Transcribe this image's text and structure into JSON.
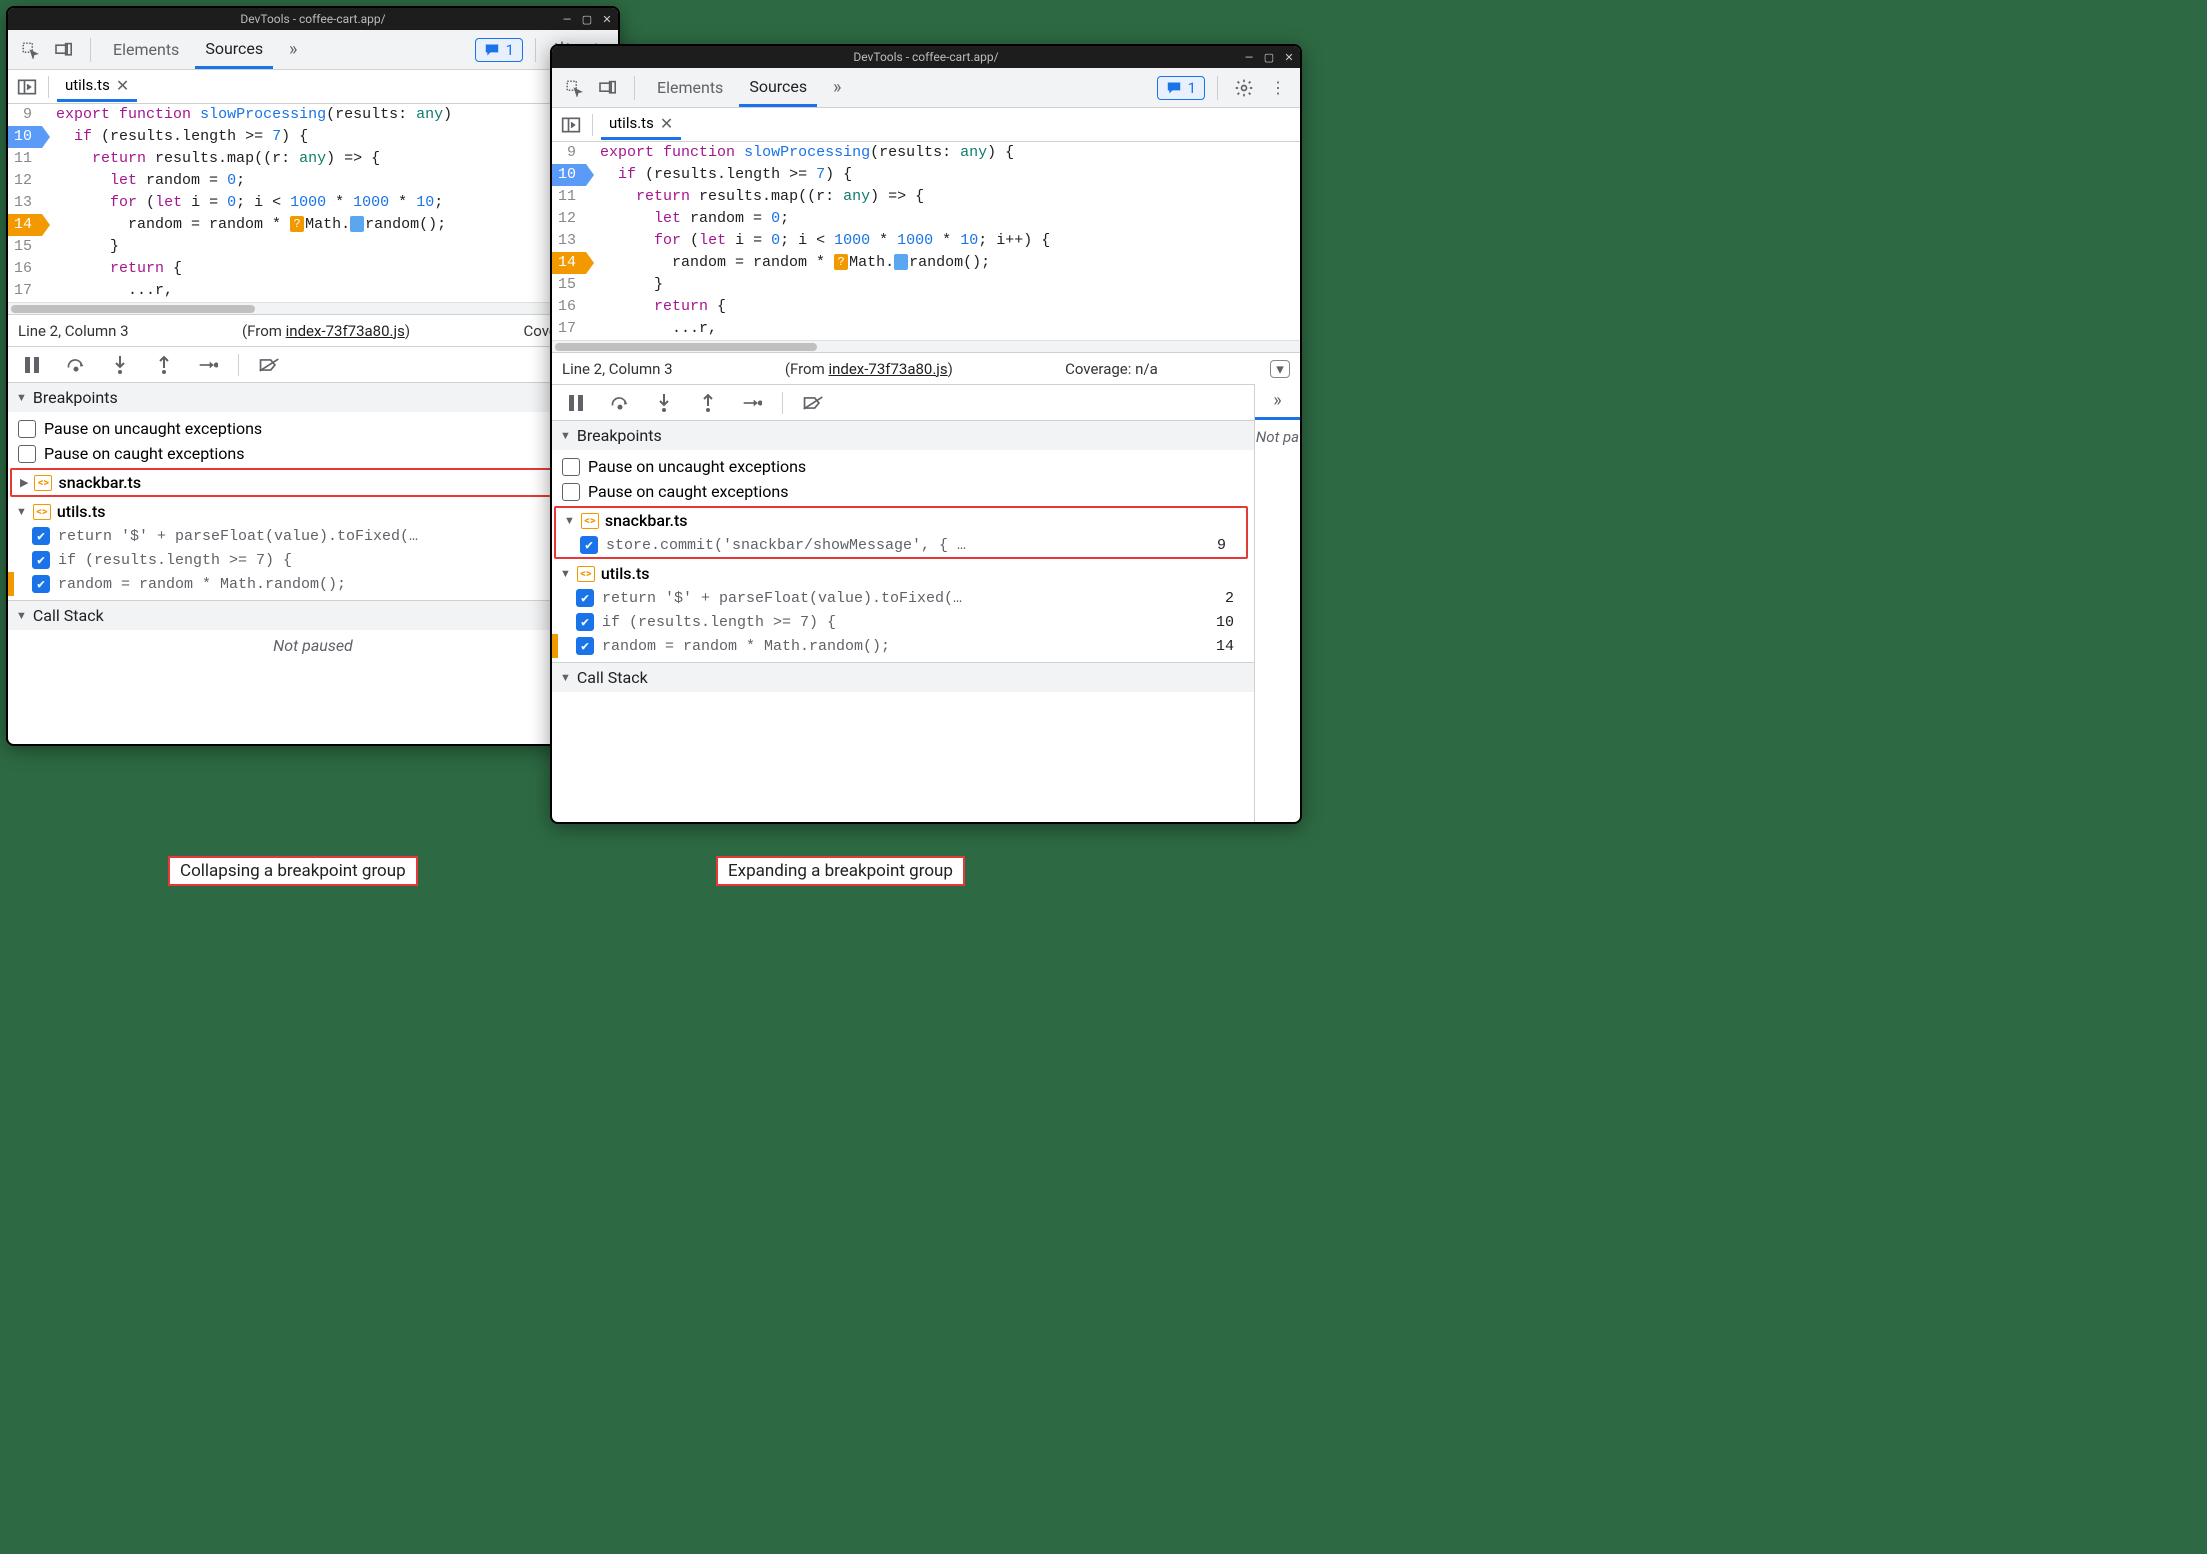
{
  "shared": {
    "window_title": "DevTools - coffee-cart.app/",
    "tabs": {
      "elements": "Elements",
      "sources": "Sources"
    },
    "issues_count": "1",
    "file_tab": "utils.ts",
    "code_lines": [
      {
        "n": "9",
        "html": "<span class='kw'>export</span> <span class='kw'>function</span> <span class='fn'>slowProcessing</span>(<span class='ident'>results</span>: <span class='type'>any</span>)"
      },
      {
        "n": "10",
        "html": "  <span class='kw'>if</span> (results.length >= <span class='num'>7</span>) {",
        "bp": true
      },
      {
        "n": "11",
        "html": "    <span class='kw'>return</span> results.map((<span class='ident'>r</span>: <span class='type'>any</span>) => {"
      },
      {
        "n": "12",
        "html": "      <span class='kw'>let</span> random = <span class='num'>0</span>;"
      },
      {
        "n": "13",
        "html": "      <span class='kw'>for</span> (<span class='kw'>let</span> i = <span class='num'>0</span>; i < <span class='num'>1000</span> * <span class='num'>1000</span> * <span class='num'>10</span>;"
      },
      {
        "n": "14",
        "html": "        random = random * <span class='inline-marker'>?</span>Math.<span class='inline-marker blue'>&nbsp;</span>random();",
        "cond": true
      },
      {
        "n": "15",
        "html": "      }"
      },
      {
        "n": "16",
        "html": "      <span class='kw'>return</span> {"
      },
      {
        "n": "17",
        "html": "        ...r,"
      }
    ],
    "code_line13_full": "      <span class='kw'>for</span> (<span class='kw'>let</span> i = <span class='num'>0</span>; i < <span class='num'>1000</span> * <span class='num'>1000</span> * <span class='num'>10</span>; i++) {",
    "code_line9_suffix_left": "",
    "code_line9_suffix_right": " {",
    "status_pos": "Line 2, Column 3",
    "status_from_prefix": "(From ",
    "status_from_link": "index-73f73a80.js",
    "status_from_suffix": ")",
    "status_coverage_left": "Coverage: n/",
    "status_coverage_right": "Coverage: n/a",
    "breakpoints_header": "Breakpoints",
    "pause_uncaught": "Pause on uncaught exceptions",
    "pause_caught": "Pause on caught exceptions",
    "snackbar_file": "snackbar.ts",
    "utils_file": "utils.ts",
    "snackbar_bp": {
      "text": "store.commit('snackbar/showMessage', { …",
      "line": "9"
    },
    "utils_bps": [
      {
        "text": "return '$' + parseFloat(value).toFixed(…",
        "line": "2"
      },
      {
        "text": "if (results.length >= 7) {",
        "line": "10"
      },
      {
        "text": "random = random * Math.random();",
        "line": "14",
        "orange": true
      }
    ],
    "callstack_header": "Call Stack",
    "not_paused": "Not paused",
    "right_not_paused": "Not pa"
  },
  "captions": {
    "left": "Collapsing a breakpoint group",
    "right": "Expanding a breakpoint group"
  }
}
